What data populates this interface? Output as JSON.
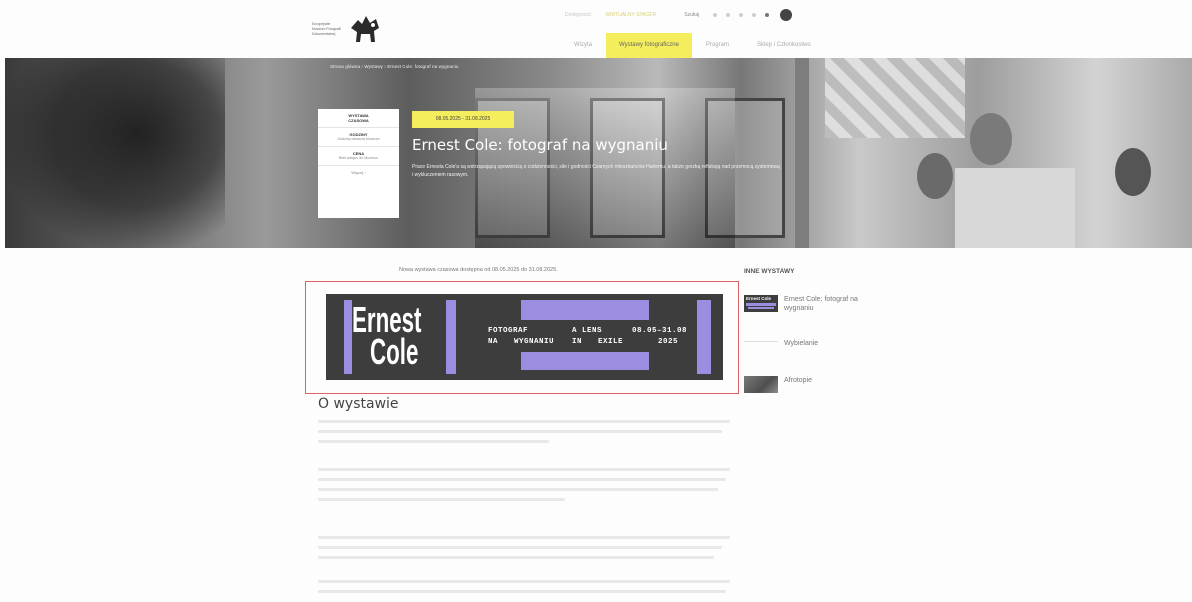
{
  "header": {
    "logo_text": "Europejskie Muzeum Fotografii Dokumentalnej",
    "top_links": [
      "Dostępność",
      "WIRTUALNY SPACER",
      "",
      "Szukaj"
    ],
    "nav": [
      {
        "label": "Wizyta",
        "active": false
      },
      {
        "label": "Wystawy fotograficzne",
        "active": true
      },
      {
        "label": "Program",
        "active": false
      },
      {
        "label": "Sklep i Członkostwo",
        "active": false
      }
    ]
  },
  "hero": {
    "breadcrumb": "Strona główna › Wystawy › Ernest Cole: fotograf na wygnaniu",
    "date_badge": "08.05.2025 - 31.08.2025",
    "title": "Ernest Cole: fotograf na wygnaniu",
    "description": "Prace Ernesta Cole'a są wstrząsającą opowieścią o codzienności, sile i godności Czarnych mieszkańców Harlemu, a także gorzką refleksją nad przemocą systemową i wykluczeniem rasowym.",
    "info": {
      "type_label": "WYSTAWA",
      "type_value": "CZASOWA",
      "hours_label": "GODZINY",
      "hours_value": "Godziny otwarcia Muzeum",
      "price_label": "CENA",
      "price_value": "Bilet wstępu do Muzeum",
      "link": "Więcej ›"
    }
  },
  "content": {
    "intro": "Nowa wystawa czasowa dostępna od 08.05.2025 do 31.08.2025.",
    "banner": {
      "hint": "",
      "title_line1": "Ernest",
      "title_line2": "Cole",
      "col1": [
        "FOTOGRAF",
        "NA"
      ],
      "col2": [
        "WYGNANIU"
      ],
      "col3": [
        "A LENS",
        "IN"
      ],
      "col4": [
        "EXILE"
      ],
      "dates": "08.05–31.08",
      "year": "2025"
    },
    "about_title": "O wystawie"
  },
  "sidebar": {
    "title": "INNE WYSTAWY",
    "items": [
      {
        "label": "Ernest Cole: fotograf na wygnaniu",
        "thumb": "Ernest Cole"
      },
      {
        "label": "Wybielanie",
        "thumb": ""
      },
      {
        "label": "Afrotopie",
        "thumb": ""
      }
    ]
  },
  "colors": {
    "accent": "#f4ee5c",
    "banner_bg": "#3d3d3d",
    "banner_accent": "#9c8de0",
    "highlight_frame": "#e06363"
  }
}
